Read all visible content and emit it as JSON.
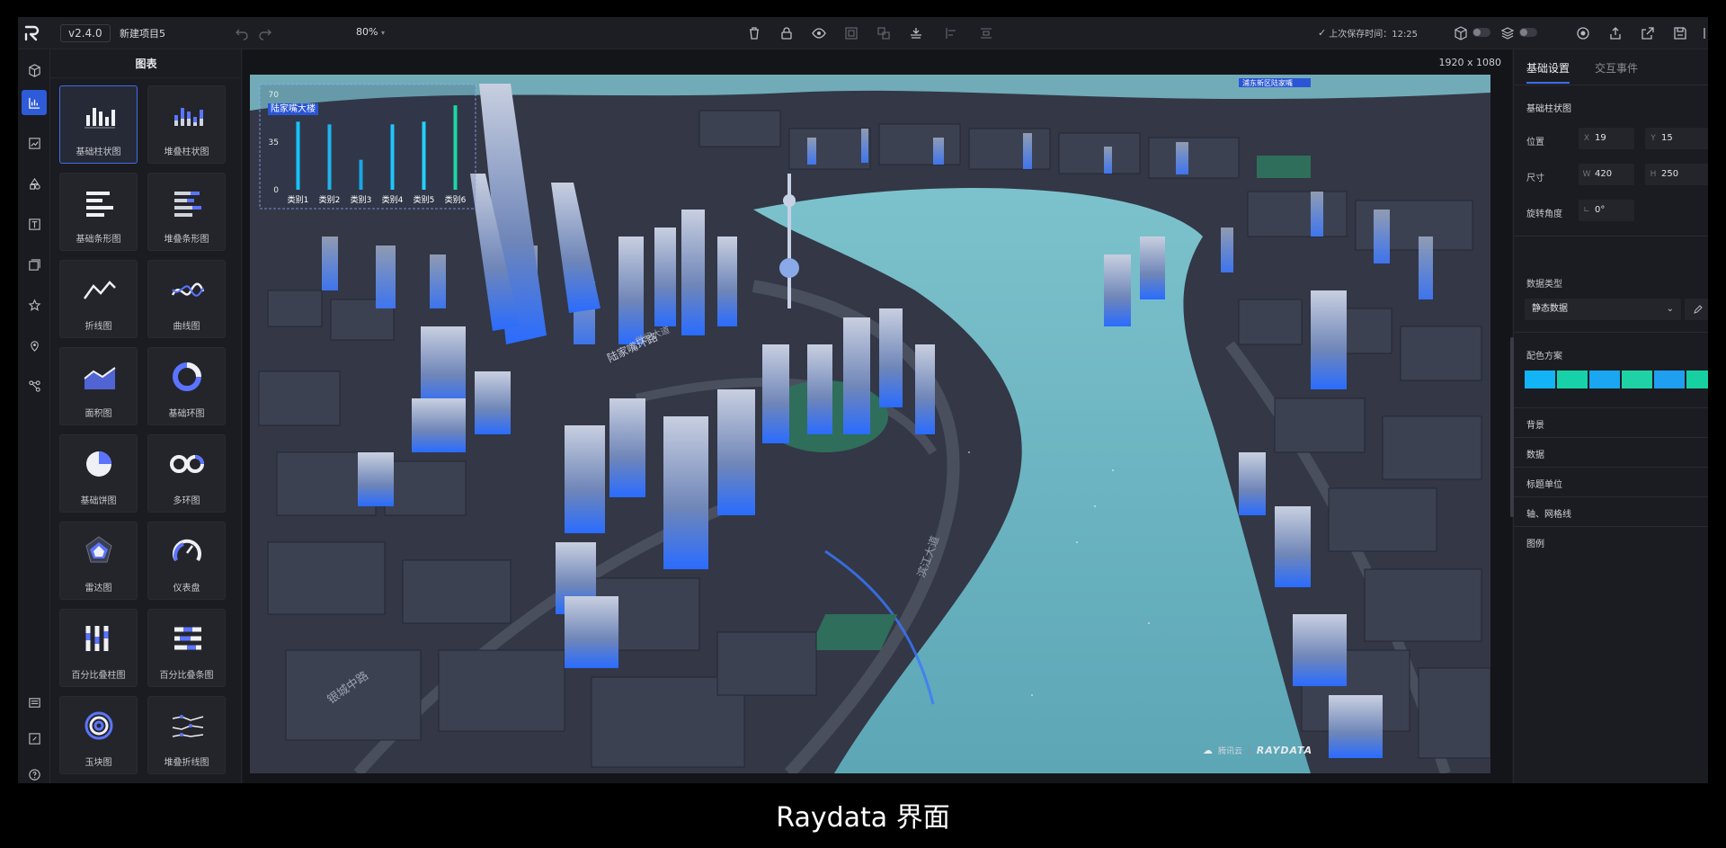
{
  "topbar": {
    "version": "v2.4.0",
    "project_name": "新建项目5",
    "zoom": "80%",
    "save_time": "上次保存时间：12:25"
  },
  "library": {
    "title": "图表",
    "items": [
      {
        "label": "基础柱状图",
        "icon": "bar-chart-icon"
      },
      {
        "label": "堆叠柱状图",
        "icon": "stacked-bar-icon"
      },
      {
        "label": "基础条形图",
        "icon": "hbar-icon"
      },
      {
        "label": "堆叠条形图",
        "icon": "stacked-hbar-icon"
      },
      {
        "label": "折线图",
        "icon": "line-chart-icon"
      },
      {
        "label": "曲线图",
        "icon": "curve-chart-icon"
      },
      {
        "label": "面积图",
        "icon": "area-chart-icon"
      },
      {
        "label": "基础环图",
        "icon": "ring-chart-icon"
      },
      {
        "label": "基础饼图",
        "icon": "pie-chart-icon"
      },
      {
        "label": "多环图",
        "icon": "multi-ring-icon"
      },
      {
        "label": "雷达图",
        "icon": "radar-chart-icon"
      },
      {
        "label": "仪表盘",
        "icon": "gauge-icon"
      },
      {
        "label": "百分比叠柱图",
        "icon": "percent-bar-icon"
      },
      {
        "label": "百分比叠条图",
        "icon": "percent-hbar-icon"
      },
      {
        "label": "玉块图",
        "icon": "jade-ring-icon"
      },
      {
        "label": "堆叠折线图",
        "icon": "stacked-line-icon"
      }
    ]
  },
  "canvas": {
    "resolution": "1920 x 1080",
    "brand_cloud": "腾讯云",
    "brand_name": "RAYDATA",
    "map_labels": [
      "世纪大道",
      "滨江大道",
      "银城中路",
      "陆家嘴环路"
    ],
    "top_label": "浦东新区陆家嘴"
  },
  "chart_data": {
    "type": "bar",
    "title": "陆家嘴大楼",
    "categories": [
      "类别1",
      "类别2",
      "类别3",
      "类别4",
      "类别5",
      "类别6"
    ],
    "values": [
      50,
      48,
      22,
      48,
      50,
      62
    ],
    "y_ticks": [
      "0",
      "35",
      "70"
    ],
    "ylim": [
      0,
      70
    ],
    "colors": [
      "#15c3ff",
      "#1fb4ee",
      "#19a6e8",
      "#1fc6ff",
      "#22d0ff",
      "#1ed6a4"
    ]
  },
  "props": {
    "tabs": [
      "基础设置",
      "交互事件"
    ],
    "component_name": "基础柱状图",
    "position_label": "位置",
    "x_prefix": "X",
    "x_value": "19",
    "y_prefix": "Y",
    "y_value": "15",
    "size_label": "尺寸",
    "w_prefix": "W",
    "w_value": "420",
    "h_prefix": "H",
    "h_value": "250",
    "rotation_label": "旋转角度",
    "rotation_value": "0°",
    "data_type_label": "数据类型",
    "data_type_value": "静态数据",
    "palette_label": "配色方案",
    "palette": [
      "#12b4f5",
      "#17d2a8",
      "#1aa6f0",
      "#1fd2a6",
      "#1e9ff0",
      "#16d0a2"
    ],
    "sections": [
      "背景",
      "数据",
      "标题单位",
      "轴、网格线",
      "图例"
    ]
  },
  "caption": "Raydata 界面"
}
